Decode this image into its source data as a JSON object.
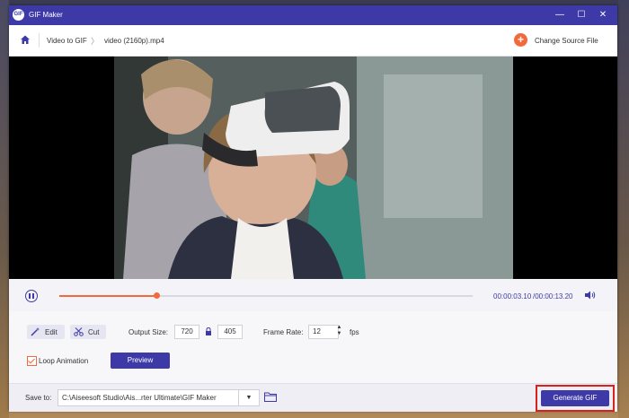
{
  "window": {
    "title": "GIF Maker",
    "logo_text": "GIF",
    "controls": {
      "minimize": "—",
      "maximize": "☐",
      "close": "✕"
    }
  },
  "nav": {
    "breadcrumb": [
      "Video to GIF",
      "video (2160p).mp4"
    ],
    "breadcrumb_separator": "〉",
    "change_source_label": "Change Source File",
    "change_source_icon": "plus-icon"
  },
  "player": {
    "progress_fraction": 0.2348,
    "current_time": "00:00:03.10",
    "total_time": "/00:00:13.20",
    "play_state": "playing"
  },
  "options": {
    "edit_label": "Edit",
    "cut_label": "Cut",
    "output_size_label": "Output Size:",
    "width": "720",
    "height": "405",
    "frame_rate_label": "Frame Rate:",
    "frame_rate": "12",
    "fps_label": "fps",
    "loop_label": "Loop Animation",
    "loop_checked": true,
    "preview_label": "Preview"
  },
  "save": {
    "label": "Save to:",
    "path": "C:\\Aiseesoft Studio\\Ais...rter Ultimate\\GIF Maker",
    "generate_label": "Generate GIF"
  },
  "colors": {
    "accent": "#3d3aa8",
    "orange": "#f26a3c",
    "highlight": "#d8221e"
  }
}
